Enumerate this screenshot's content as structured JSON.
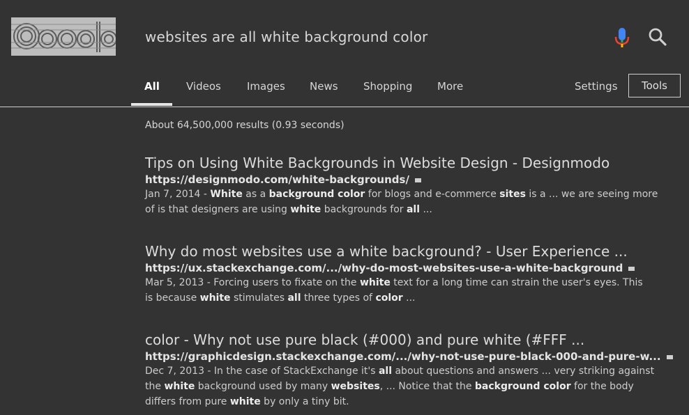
{
  "search": {
    "query": "websites are all white background color"
  },
  "tabs": [
    {
      "label": "All",
      "active": true
    },
    {
      "label": "Videos"
    },
    {
      "label": "Images"
    },
    {
      "label": "News"
    },
    {
      "label": "Shopping"
    },
    {
      "label": "More"
    }
  ],
  "settings_label": "Settings",
  "tools_label": "Tools",
  "stats": "About 64,500,000 results (0.93 seconds)",
  "results": [
    {
      "title": "Tips on Using White Backgrounds in Website Design - Designmodo",
      "url": "https://designmodo.com/white-backgrounds/",
      "snippet_line1": [
        {
          "t": "Jan 7, 2014 - "
        },
        {
          "t": "White",
          "b": true
        },
        {
          "t": " as a "
        },
        {
          "t": "background color",
          "b": true
        },
        {
          "t": " for blogs and e-commerce "
        },
        {
          "t": "sites",
          "b": true
        },
        {
          "t": " is a ... we are seeing more"
        }
      ],
      "snippet_line2": [
        {
          "t": "of is that designers are using "
        },
        {
          "t": "white",
          "b": true
        },
        {
          "t": " backgrounds for "
        },
        {
          "t": "all",
          "b": true
        },
        {
          "t": " ..."
        }
      ]
    },
    {
      "title": "Why do most websites use a white background? - User Experience ...",
      "url": "https://ux.stackexchange.com/.../why-do-most-websites-use-a-white-background",
      "snippet_line1": [
        {
          "t": "Mar 5, 2013 - Forcing users to fixate on the "
        },
        {
          "t": "white",
          "b": true
        },
        {
          "t": " text for a long time can strain the user's eyes. This"
        }
      ],
      "snippet_line2": [
        {
          "t": "is because "
        },
        {
          "t": "white",
          "b": true
        },
        {
          "t": " stimulates "
        },
        {
          "t": "all",
          "b": true
        },
        {
          "t": " three types of "
        },
        {
          "t": "color",
          "b": true
        },
        {
          "t": " ..."
        }
      ]
    },
    {
      "title": "color - Why not use pure black (#000) and pure white (#FFF ...",
      "url": "https://graphicdesign.stackexchange.com/.../why-not-use-pure-black-000-and-pure-w...",
      "snippet_line1": [
        {
          "t": "Dec 7, 2013 - In the case of StackExchange it's "
        },
        {
          "t": "all",
          "b": true
        },
        {
          "t": " about questions and answers ... very striking against"
        }
      ],
      "snippet_line2": [
        {
          "t": "the "
        },
        {
          "t": "white",
          "b": true
        },
        {
          "t": " background used by many "
        },
        {
          "t": "websites",
          "b": true
        },
        {
          "t": ", ... Notice that the "
        },
        {
          "t": "background color",
          "b": true
        },
        {
          "t": " for the body"
        }
      ],
      "snippet_line3": [
        {
          "t": "differs from pure "
        },
        {
          "t": "white",
          "b": true
        },
        {
          "t": " by only a tiny bit."
        }
      ]
    }
  ]
}
